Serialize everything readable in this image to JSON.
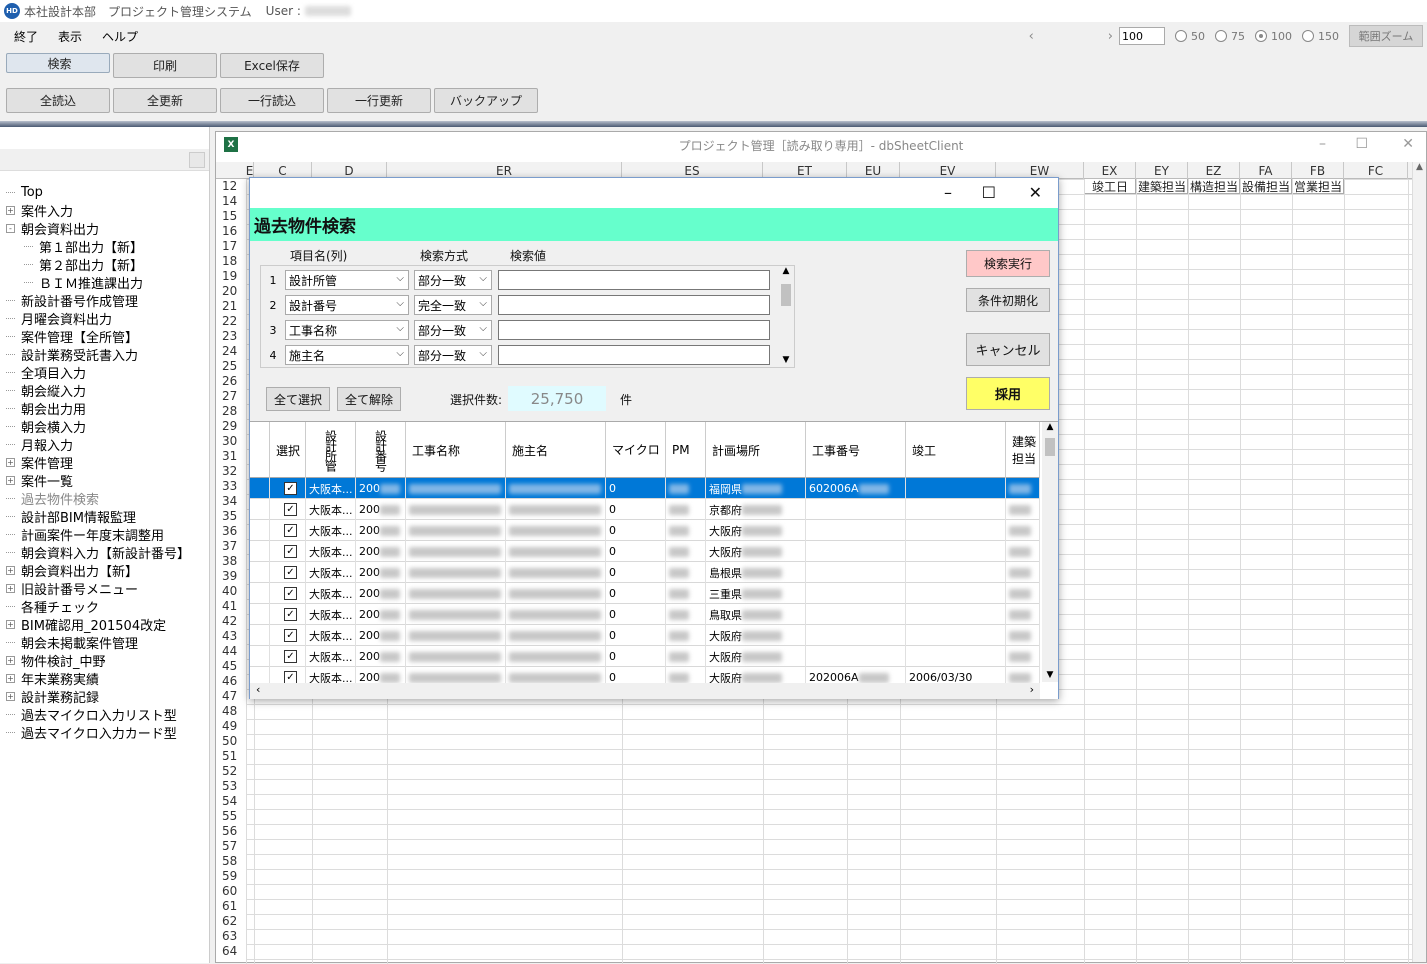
{
  "app": {
    "title": "本社設計本部　プロジェクト管理システム",
    "user_label": "User :",
    "logo_text": "HD"
  },
  "menu": [
    "終了",
    "表示",
    "ヘルプ"
  ],
  "zoom": {
    "value": "100",
    "options": [
      "50",
      "75",
      "100",
      "150"
    ],
    "selected": "100",
    "range_zoom_label": "範囲ズーム"
  },
  "toolbar1": [
    "検索",
    "印刷",
    "Excel保存"
  ],
  "toolbar2": [
    "全読込",
    "全更新",
    "一行読込",
    "一行更新",
    "バックアップ"
  ],
  "tree": [
    {
      "label": "Top",
      "exp": ""
    },
    {
      "label": "案件入力",
      "exp": "+"
    },
    {
      "label": "朝会資料出力",
      "exp": "-"
    },
    {
      "label": "第１部出力【新】",
      "exp": "",
      "indent": 2
    },
    {
      "label": "第２部出力【新】",
      "exp": "",
      "indent": 2
    },
    {
      "label": "ＢＩＭ推進課出力",
      "exp": "",
      "indent": 2
    },
    {
      "label": "新設計番号作成管理",
      "exp": ""
    },
    {
      "label": "月曜会資料出力",
      "exp": ""
    },
    {
      "label": "案件管理【全所管】",
      "exp": ""
    },
    {
      "label": "設計業務受託書入力",
      "exp": ""
    },
    {
      "label": "全項目入力",
      "exp": ""
    },
    {
      "label": "朝会縦入力",
      "exp": ""
    },
    {
      "label": "朝会出力用",
      "exp": ""
    },
    {
      "label": "朝会横入力",
      "exp": ""
    },
    {
      "label": "月報入力",
      "exp": ""
    },
    {
      "label": "案件管理",
      "exp": "+"
    },
    {
      "label": "案件一覧",
      "exp": "+"
    },
    {
      "label": "過去物件検索",
      "exp": "",
      "dim": true
    },
    {
      "label": "設計部BIM情報監理",
      "exp": ""
    },
    {
      "label": "計画案件ー年度末調整用",
      "exp": ""
    },
    {
      "label": "朝会資料入力【新設計番号】",
      "exp": ""
    },
    {
      "label": "朝会資料出力【新】",
      "exp": "+"
    },
    {
      "label": "旧設計番号メニュー",
      "exp": "+"
    },
    {
      "label": "各種チェック",
      "exp": ""
    },
    {
      "label": "BIM確認用_201504改定",
      "exp": "+"
    },
    {
      "label": "朝会未掲載案件管理",
      "exp": ""
    },
    {
      "label": "物件検討_中野",
      "exp": "+"
    },
    {
      "label": "年末業務実績",
      "exp": "+"
    },
    {
      "label": "設計業務記録",
      "exp": "+"
    },
    {
      "label": "過去マイクロ入力リスト型",
      "exp": ""
    },
    {
      "label": "過去マイクロ入力カード型",
      "exp": ""
    }
  ],
  "sheet": {
    "title": "プロジェクト管理［読み取り専用］- dbSheetClient",
    "columns": [
      "E",
      "C",
      "D",
      "ER",
      "ES",
      "ET",
      "EU",
      "EV",
      "EW",
      "EX",
      "EY",
      "EZ",
      "FA",
      "FB",
      "FC"
    ],
    "header_cells": [
      "竣工日",
      "建築担当",
      "構造担当",
      "設備担当",
      "営業担当"
    ],
    "rows_start": 12,
    "rows": [
      "12",
      "14",
      "15",
      "16",
      "17",
      "18",
      "19",
      "20",
      "21",
      "22",
      "23",
      "24",
      "25",
      "26",
      "27",
      "28",
      "29",
      "30",
      "31",
      "32",
      "33",
      "34",
      "35",
      "36",
      "37",
      "38",
      "39",
      "40",
      "41",
      "42",
      "43",
      "44",
      "45",
      "46",
      "47",
      "48",
      "49",
      "50",
      "51",
      "52",
      "53",
      "54",
      "55",
      "56",
      "57",
      "58",
      "59",
      "60",
      "61",
      "62",
      "63",
      "64"
    ]
  },
  "dialog": {
    "title": "過去物件検索",
    "col_item": "項目名(列)",
    "col_method": "検索方式",
    "col_value": "検索値",
    "conditions": [
      {
        "no": "1",
        "item": "設計所管",
        "method": "部分一致",
        "value": ""
      },
      {
        "no": "2",
        "item": "設計番号",
        "method": "完全一致",
        "value": ""
      },
      {
        "no": "3",
        "item": "工事名称",
        "method": "部分一致",
        "value": ""
      },
      {
        "no": "4",
        "item": "施主名",
        "method": "部分一致",
        "value": ""
      }
    ],
    "buttons": {
      "search": "検索実行",
      "reset": "条件初期化",
      "cancel": "キャンセル",
      "adopt": "採用",
      "select_all": "全て選択",
      "clear_all": "全て解除"
    },
    "count_label": "選択件数:",
    "count_value": "25,750",
    "count_unit": "件",
    "colors": {
      "header_bg": "#66ffcc",
      "search_btn": "#ffc8c8",
      "adopt_btn": "#ffff66",
      "highlight": "#0078d7"
    }
  },
  "results": {
    "headers": [
      "選択",
      "設計所管",
      "設計番号",
      "工事名称",
      "施主名",
      "マイクロ",
      "PM",
      "計画場所",
      "工事番号",
      "竣工",
      "建築担当"
    ],
    "rows": [
      {
        "checked": true,
        "office": "大阪本...",
        "num": "200",
        "micro": "0",
        "place": "福岡県",
        "koji": "602006A",
        "done": "",
        "hl": true
      },
      {
        "checked": true,
        "office": "大阪本...",
        "num": "200",
        "micro": "0",
        "place": "京都府",
        "koji": "",
        "done": ""
      },
      {
        "checked": true,
        "office": "大阪本...",
        "num": "200",
        "micro": "0",
        "place": "大阪府",
        "koji": "",
        "done": ""
      },
      {
        "checked": true,
        "office": "大阪本...",
        "num": "200",
        "micro": "0",
        "place": "大阪府",
        "koji": "",
        "done": ""
      },
      {
        "checked": true,
        "office": "大阪本...",
        "num": "200",
        "micro": "0",
        "place": "島根県",
        "koji": "",
        "done": ""
      },
      {
        "checked": true,
        "office": "大阪本...",
        "num": "200",
        "micro": "0",
        "place": "三重県",
        "koji": "",
        "done": ""
      },
      {
        "checked": true,
        "office": "大阪本...",
        "num": "200",
        "micro": "0",
        "place": "鳥取県",
        "koji": "",
        "done": ""
      },
      {
        "checked": true,
        "office": "大阪本...",
        "num": "200",
        "micro": "0",
        "place": "大阪府",
        "koji": "",
        "done": ""
      },
      {
        "checked": true,
        "office": "大阪本...",
        "num": "200",
        "micro": "0",
        "place": "大阪府",
        "koji": "",
        "done": ""
      },
      {
        "checked": true,
        "office": "大阪本...",
        "num": "200",
        "micro": "0",
        "place": "大阪府",
        "koji": "202006A",
        "done": "2006/03/30"
      }
    ]
  }
}
